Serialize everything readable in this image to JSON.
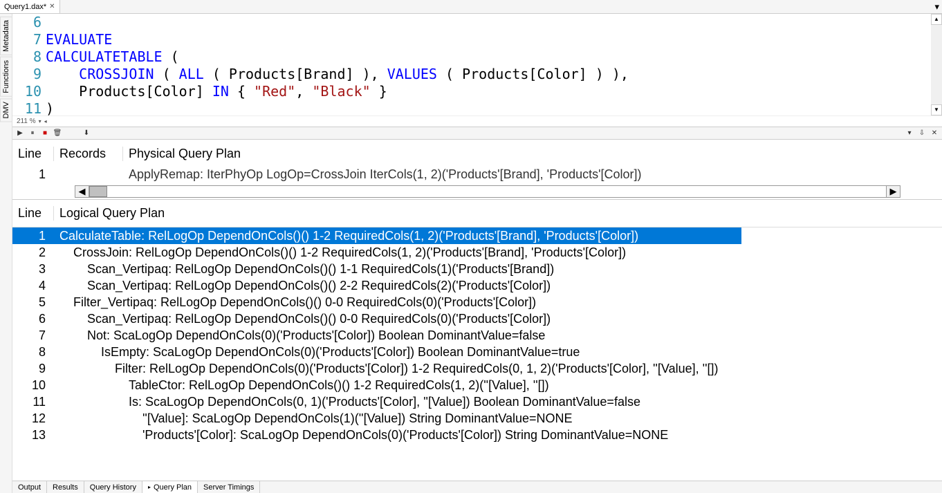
{
  "tab": {
    "title": "Query1.dax*"
  },
  "side_tabs": [
    "Metadata",
    "Functions",
    "DMV"
  ],
  "editor": {
    "lines": [
      {
        "n": 6,
        "raw": ""
      },
      {
        "n": 7,
        "raw": "EVALUATE"
      },
      {
        "n": 8,
        "raw": "CALCULATETABLE ("
      },
      {
        "n": 9,
        "raw": "    CROSSJOIN ( ALL ( Products[Brand] ), VALUES ( Products[Color] ) ),"
      },
      {
        "n": 10,
        "raw": "    Products[Color] IN { \"Red\", \"Black\" }"
      },
      {
        "n": 11,
        "raw": ")"
      }
    ],
    "status": "211 %",
    "syntax": {
      "keywords": [
        "EVALUATE",
        "IN"
      ],
      "functions": [
        "CALCULATETABLE",
        "CROSSJOIN",
        "ALL",
        "VALUES"
      ],
      "strings": [
        "\"Red\"",
        "\"Black\""
      ]
    }
  },
  "physical": {
    "headers": {
      "line": "Line",
      "records": "Records",
      "plan": "Physical Query Plan"
    },
    "rows": [
      {
        "line": 1,
        "records": "",
        "text": "ApplyRemap: IterPhyOp LogOp=CrossJoin IterCols(1, 2)('Products'[Brand], 'Products'[Color])"
      }
    ]
  },
  "logical": {
    "headers": {
      "line": "Line",
      "plan": "Logical Query Plan"
    },
    "rows": [
      {
        "line": 1,
        "indent": 0,
        "selected": true,
        "text": "CalculateTable: RelLogOp DependOnCols()() 1-2 RequiredCols(1, 2)('Products'[Brand], 'Products'[Color])"
      },
      {
        "line": 2,
        "indent": 1,
        "selected": false,
        "text": "CrossJoin: RelLogOp DependOnCols()() 1-2 RequiredCols(1, 2)('Products'[Brand], 'Products'[Color])"
      },
      {
        "line": 3,
        "indent": 2,
        "selected": false,
        "text": "Scan_Vertipaq: RelLogOp DependOnCols()() 1-1 RequiredCols(1)('Products'[Brand])"
      },
      {
        "line": 4,
        "indent": 2,
        "selected": false,
        "text": "Scan_Vertipaq: RelLogOp DependOnCols()() 2-2 RequiredCols(2)('Products'[Color])"
      },
      {
        "line": 5,
        "indent": 1,
        "selected": false,
        "text": "Filter_Vertipaq: RelLogOp DependOnCols()() 0-0 RequiredCols(0)('Products'[Color])"
      },
      {
        "line": 6,
        "indent": 2,
        "selected": false,
        "text": "Scan_Vertipaq: RelLogOp DependOnCols()() 0-0 RequiredCols(0)('Products'[Color])"
      },
      {
        "line": 7,
        "indent": 2,
        "selected": false,
        "text": "Not: ScaLogOp DependOnCols(0)('Products'[Color]) Boolean DominantValue=false"
      },
      {
        "line": 8,
        "indent": 3,
        "selected": false,
        "text": "IsEmpty: ScaLogOp DependOnCols(0)('Products'[Color]) Boolean DominantValue=true"
      },
      {
        "line": 9,
        "indent": 4,
        "selected": false,
        "text": "Filter: RelLogOp DependOnCols(0)('Products'[Color]) 1-2 RequiredCols(0, 1, 2)('Products'[Color], ''[Value], ''[])"
      },
      {
        "line": 10,
        "indent": 5,
        "selected": false,
        "text": "TableCtor: RelLogOp DependOnCols()() 1-2 RequiredCols(1, 2)(''[Value], ''[])"
      },
      {
        "line": 11,
        "indent": 5,
        "selected": false,
        "text": "Is: ScaLogOp DependOnCols(0, 1)('Products'[Color], ''[Value]) Boolean DominantValue=false"
      },
      {
        "line": 12,
        "indent": 6,
        "selected": false,
        "text": "''[Value]: ScaLogOp DependOnCols(1)(''[Value]) String DominantValue=NONE"
      },
      {
        "line": 13,
        "indent": 6,
        "selected": false,
        "text": "'Products'[Color]: ScaLogOp DependOnCols(0)('Products'[Color]) String DominantValue=NONE"
      }
    ]
  },
  "bottom_tabs": [
    {
      "label": "Output",
      "active": false
    },
    {
      "label": "Results",
      "active": false
    },
    {
      "label": "Query History",
      "active": false
    },
    {
      "label": "Query Plan",
      "active": true
    },
    {
      "label": "Server Timings",
      "active": false
    }
  ]
}
